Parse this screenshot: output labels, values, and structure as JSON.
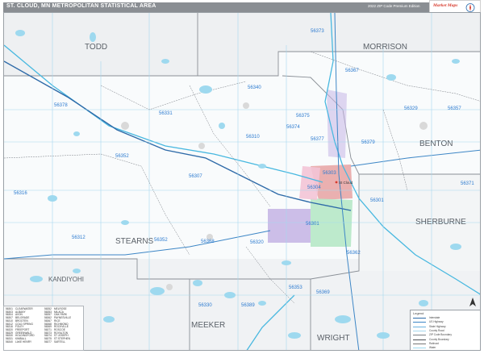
{
  "map": {
    "title": "ST. CLOUD, MN METROPOLITAN STATISTICAL AREA",
    "edition": "2022 ZIP Code Premium Edition",
    "publisher_logo_text": "Market Maps",
    "counties": [
      {
        "name": "TODD"
      },
      {
        "name": "MORRISON"
      },
      {
        "name": "BENTON"
      },
      {
        "name": "SHERBURNE"
      },
      {
        "name": "STEARNS"
      },
      {
        "name": "MEEKER"
      },
      {
        "name": "WRIGHT"
      },
      {
        "name": "KANDIYOHI"
      }
    ],
    "zip_codes": [
      "56373",
      "56367",
      "56340",
      "56378",
      "56331",
      "56375",
      "56329",
      "56357",
      "56374",
      "56310",
      "56377",
      "56379",
      "56352",
      "56307",
      "56303",
      "56304",
      "56316",
      "56301",
      "56371",
      "56312",
      "56368",
      "56320",
      "56352",
      "56362",
      "56353",
      "56369",
      "56330",
      "56389",
      "56320",
      "56301"
    ],
    "cities": [
      "St Cloud"
    ],
    "colors": {
      "water": "#9ed9ef",
      "river": "#48b8e0",
      "road": "#a6d8ee",
      "highway": "#2e6aa8",
      "zip_label": "#2d7bd0",
      "county_label": "#5b6168",
      "county_border": "#8a8f96",
      "urban_red": "#e8a2a2",
      "urban_purple": "#c7b7e6",
      "urban_green": "#b6e8c7",
      "urban_pink": "#f3c4d6"
    }
  },
  "index_table": {
    "col1": "56301\n56303\n56304\n56307\n56310\n56312\n56316\n56320\n56329\n56330\n56331\n56340",
    "col2": "CLEARWATER\nALBANY\nAVON\nBELGRADE\nBROOTEN\nCOLD SPRING\nFOLEY\nFREEPORT\nGREENWALD\nHOLDINGFORD\nKIMBALL\nLAKE HENRY",
    "col3": "56352\n56353\n56357\n56362\n56367\n56368\n56369\n56371\n56373\n56374\n56375\n56377",
    "col4": "MELROSE\nMILACA\nOAK PARK\nPAYNESVILLE\nRICE\nRICHMOND\nROCKVILLE\nROSCOE\nROYALTON\nST JOSEPH\nST STEPHEN\nSARTELL"
  },
  "legend": {
    "title": "Legend",
    "items": [
      {
        "label": "Interstate",
        "color": "#2e6aa8"
      },
      {
        "label": "US Highway",
        "color": "#3d86c6"
      },
      {
        "label": "State Highway",
        "color": "#6bb3e0"
      },
      {
        "label": "County Road",
        "color": "#a6d8ee"
      },
      {
        "label": "ZIP Code Boundary",
        "color": "#7a7f86"
      },
      {
        "label": "County Boundary",
        "color": "#4f5358"
      },
      {
        "label": "Railroad",
        "color": "#777777"
      },
      {
        "label": "Water",
        "color": "#9ed9ef"
      }
    ]
  }
}
